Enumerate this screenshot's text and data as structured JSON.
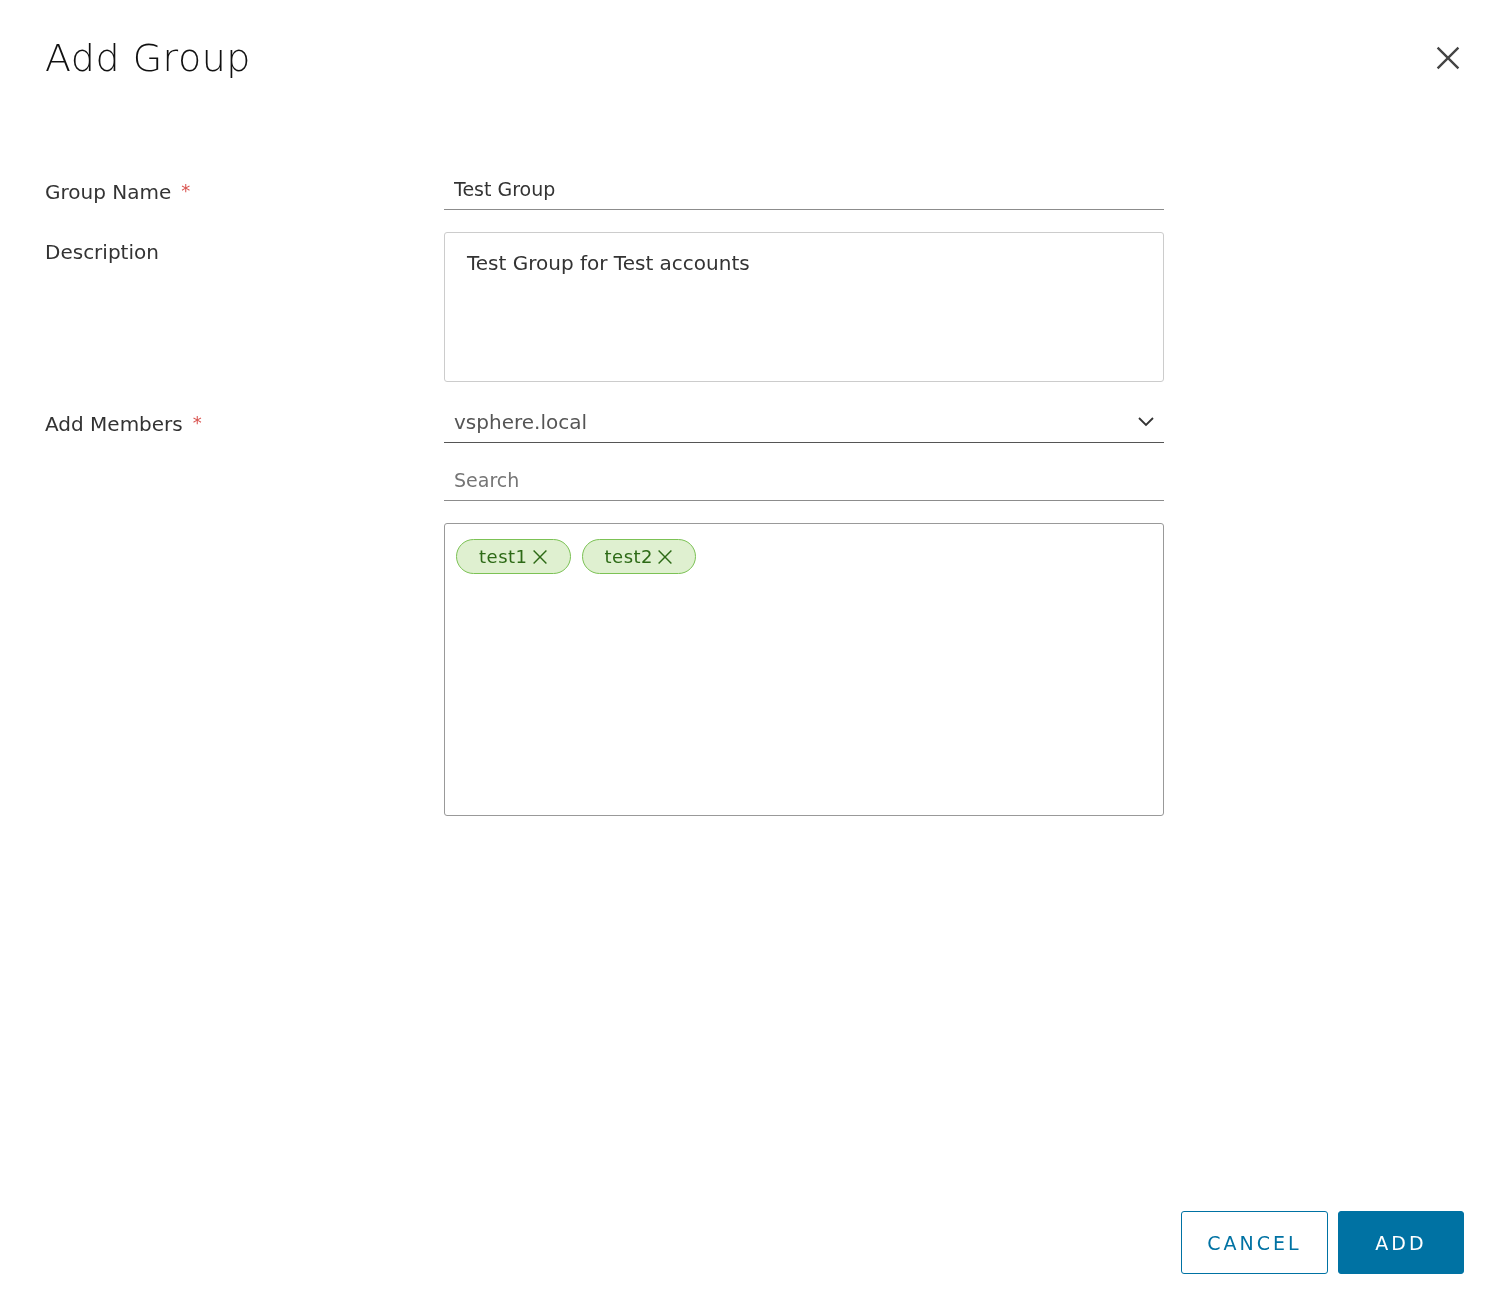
{
  "dialog": {
    "title": "Add Group"
  },
  "fields": [
    {
      "kind": "input",
      "label": "Group Name",
      "required": true,
      "value": "Test Group"
    },
    {
      "kind": "textarea",
      "label": "Description",
      "required": false,
      "value": "Test Group for Test accounts"
    },
    {
      "kind": "select",
      "label": "Add Members",
      "required": true,
      "value": "vsphere.local"
    }
  ],
  "required_marker": "*",
  "search": {
    "placeholder": "Search"
  },
  "members": [
    {
      "label": "test1"
    },
    {
      "label": "test2"
    }
  ],
  "buttons": [
    {
      "label": "CANCEL",
      "kind": "secondary"
    },
    {
      "label": "ADD",
      "kind": "primary"
    }
  ]
}
